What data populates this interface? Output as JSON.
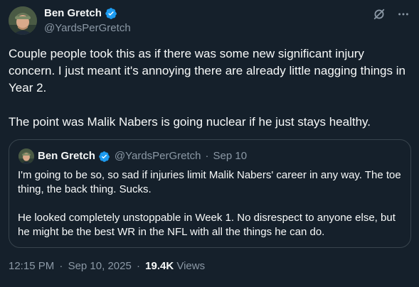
{
  "tweet": {
    "author": {
      "name": "Ben Gretch",
      "handle": "@YardsPerGretch"
    },
    "body": [
      "Couple people took this as if there was some new significant injury concern. I just meant it's annoying there are already little nagging things in Year 2.",
      "The point was Malik Nabers is going nuclear if he just stays healthy."
    ],
    "quote": {
      "name": "Ben Gretch",
      "handle": "@YardsPerGretch",
      "separator": "·",
      "date": "Sep 10",
      "body": [
        "I'm going to be so, so sad if injuries limit Malik Nabers' career in any way. The toe thing, the back thing. Sucks.",
        "He looked completely unstoppable in Week 1. No disrespect to anyone else, but he might be the best WR in the NFL with all the things he can do."
      ]
    },
    "footer": {
      "time": "12:15 PM",
      "separator": "·",
      "date": "Sep 10, 2025",
      "views_count": "19.4K",
      "views_label": "Views"
    }
  },
  "icons": {
    "verified": "verified-badge-icon",
    "grok": "grok-icon",
    "more": "more-options-icon"
  },
  "colors": {
    "background": "#15202b",
    "text": "#f7f9f9",
    "secondary": "#8b98a5",
    "border": "#38444d",
    "verified": "#1d9bf0"
  }
}
